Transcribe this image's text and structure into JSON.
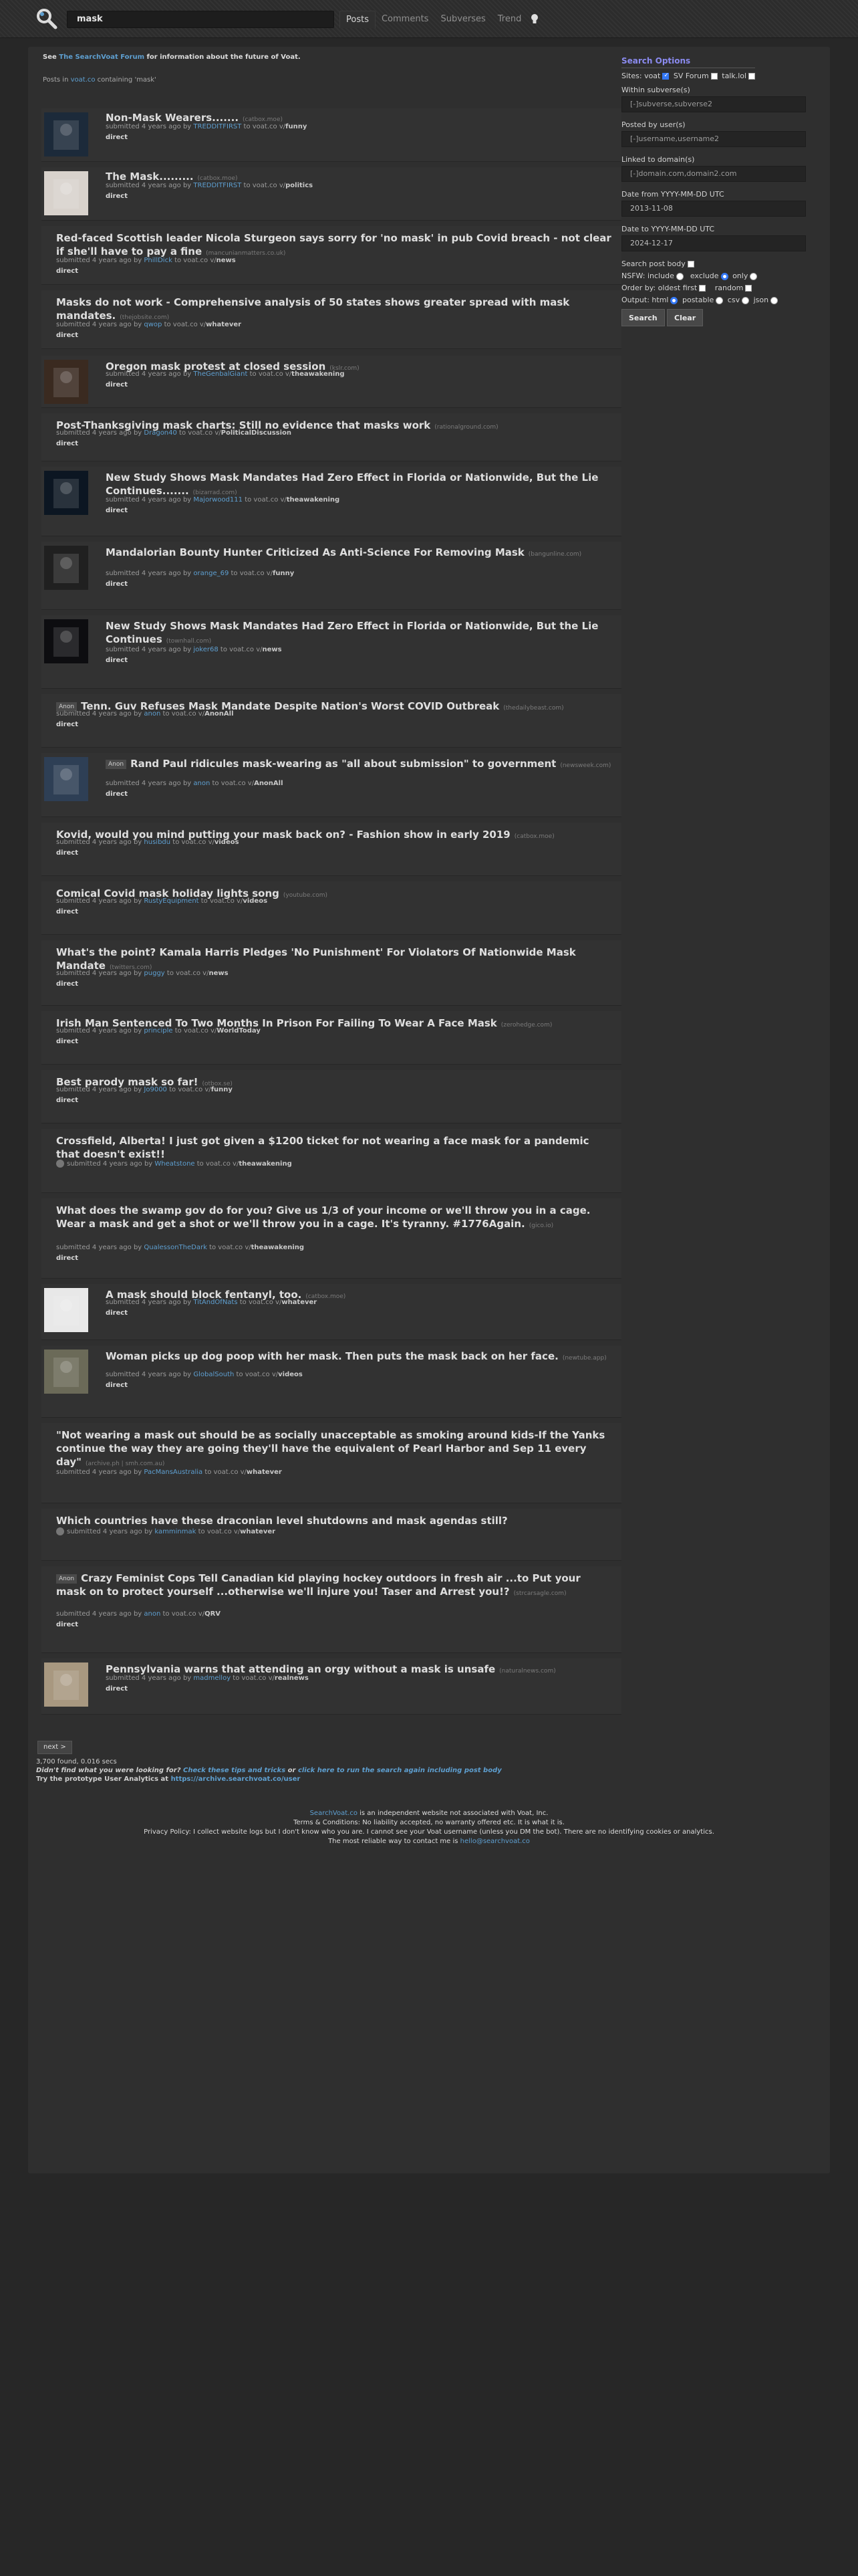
{
  "search": {
    "query": "mask"
  },
  "nav": {
    "posts": "Posts",
    "comments": "Comments",
    "subverses": "Subverses",
    "trend": "Trend"
  },
  "announce": {
    "pre": "See ",
    "link": "The SearchVoat Forum",
    "post": " for information about the future of Voat."
  },
  "posts_in": {
    "pre": "Posts in ",
    "link": "voat.co",
    "post": " containing 'mask'"
  },
  "posts": [
    {
      "title": "Non-Mask Wearers.......",
      "domain": "(catbox.moe)",
      "meta_pre": "submitted 4 years ago by ",
      "user": "TREDDITFIRST",
      "meta_mid": " to voat.co v/",
      "sub": "funny",
      "direct": "direct"
    },
    {
      "title": "The Mask.........",
      "domain": "(catbox.moe)",
      "meta_pre": "submitted 4 years ago by ",
      "user": "TREDDITFIRST",
      "meta_mid": " to voat.co v/",
      "sub": "politics",
      "direct": "direct"
    },
    {
      "title": "Red-faced Scottish leader Nicola Sturgeon says sorry for 'no mask' in pub Covid breach - not clear if she'll have to pay a fine",
      "domain": "(mancunianmatters.co.uk)",
      "meta_pre": "submitted 4 years ago by ",
      "user": "PhillDick",
      "meta_mid": " to voat.co v/",
      "sub": "news",
      "direct": "direct"
    },
    {
      "title": "Masks do not work - Comprehensive analysis of 50 states shows greater spread with mask mandates.",
      "domain": "(thejobsite.com)",
      "meta_pre": "submitted 4 years ago by ",
      "user": "qwop",
      "meta_mid": " to voat.co v/",
      "sub": "whatever",
      "direct": "direct"
    },
    {
      "title": "Oregon mask protest at closed session",
      "domain": "(kslr.com)",
      "meta_pre": "submitted 4 years ago by ",
      "user": "TheGenbalGiant",
      "meta_mid": " to voat.co v/",
      "sub": "theawakening",
      "direct": "direct"
    },
    {
      "title": "Post-Thanksgiving mask charts: Still no evidence that masks work",
      "domain": "(rationalground.com)",
      "meta_pre": "submitted 4 years ago by ",
      "user": "Dragon40",
      "meta_mid": " to voat.co v/",
      "sub": "PoliticalDiscussion",
      "direct": "direct"
    },
    {
      "title": "New Study Shows Mask Mandates Had Zero Effect in Florida or Nationwide, But the Lie Continues.......",
      "domain": "(bizarrad.com)",
      "meta_pre": "submitted 4 years ago by ",
      "user": "Majorwood111",
      "meta_mid": " to voat.co v/",
      "sub": "theawakening",
      "direct": "direct"
    },
    {
      "title": "Mandalorian Bounty Hunter Criticized As Anti-Science For Removing Mask",
      "domain": "(bangunline.com)",
      "meta_pre": "submitted 4 years ago by ",
      "user": "orange_69",
      "meta_mid": " to voat.co v/",
      "sub": "funny",
      "direct": "direct"
    },
    {
      "title": "New Study Shows Mask Mandates Had Zero Effect in Florida or Nationwide, But the Lie Continues",
      "domain": "(townhall.com)",
      "meta_pre": "submitted 4 years ago by ",
      "user": "joker68",
      "meta_mid": " to voat.co v/",
      "sub": "news",
      "direct": "direct"
    },
    {
      "anon": "Anon",
      "title": "Tenn. Guv Refuses Mask Mandate Despite Nation's Worst COVID Outbreak",
      "domain": "(thedailybeast.com)",
      "meta_pre": "submitted 4 years ago by ",
      "user": "anon",
      "meta_mid": " to voat.co v/",
      "sub": "AnonAll",
      "direct": "direct"
    },
    {
      "anon": "Anon",
      "title": "Rand Paul ridicules mask-wearing as \"all about submission\" to government",
      "domain": "(newsweek.com)",
      "meta_pre": "submitted 4 years ago by ",
      "user": "anon",
      "meta_mid": " to voat.co v/",
      "sub": "AnonAll",
      "direct": "direct"
    },
    {
      "title": "Kovid, would you mind putting your mask back on? - Fashion show in early 2019",
      "domain": "(catbox.moe)",
      "meta_pre": "submitted 4 years ago by ",
      "user": "husibdu",
      "meta_mid": " to voat.co v/",
      "sub": "videos",
      "direct": "direct"
    },
    {
      "title": "Comical Covid mask holiday lights song",
      "domain": "(youtube.com)",
      "meta_pre": "submitted 4 years ago by ",
      "user": "RustyEquipment",
      "meta_mid": " to voat.co v/",
      "sub": "videos",
      "direct": "direct"
    },
    {
      "title": "What's the point? Kamala Harris Pledges 'No Punishment' For Violators Of Nationwide Mask Mandate",
      "domain": "(twitters.com)",
      "meta_pre": "submitted 4 years ago by ",
      "user": "puggy",
      "meta_mid": " to voat.co v/",
      "sub": "news",
      "direct": "direct"
    },
    {
      "title": "Irish Man Sentenced To Two Months In Prison For Failing To Wear A Face Mask",
      "domain": "(zerohedge.com)",
      "meta_pre": "submitted 4 years ago by ",
      "user": "principle",
      "meta_mid": " to voat.co v/",
      "sub": "WorldToday",
      "direct": "direct"
    },
    {
      "title": "Best parody mask so far!",
      "domain": "(otbox.se)",
      "meta_pre": "submitted 4 years ago by ",
      "user": "Jo9000",
      "meta_mid": " to voat.co v/",
      "sub": "funny",
      "direct": "direct"
    },
    {
      "title": "Crossfield, Alberta! I just got given a $1200 ticket for not wearing a face mask for a pandemic that doesn't exist!!",
      "domain": "",
      "meta_pre": "submitted 4 years ago by ",
      "user": "Wheatstone",
      "meta_mid": " to voat.co v/",
      "sub": "theawakening",
      "direct": ""
    },
    {
      "title": "What does the swamp gov do for you? Give us 1/3 of your income or we'll throw you in a cage. Wear a mask and get a shot or we'll throw you in a cage. It's tyranny. #1776Again.",
      "domain": "(gico.io)",
      "meta_pre": "submitted 4 years ago by ",
      "user": "QualessonTheDark",
      "meta_mid": " to voat.co v/",
      "sub": "theawakening",
      "direct": "direct"
    },
    {
      "title": "A mask should block fentanyl, too.",
      "domain": "(catbox.moe)",
      "meta_pre": "submitted 4 years ago by ",
      "user": "TitAndOfNats",
      "meta_mid": " to voat.co v/",
      "sub": "whatever",
      "direct": "direct"
    },
    {
      "title": "Woman picks up dog poop with her mask. Then puts the mask back on her face.",
      "domain": "(newtube.app)",
      "meta_pre": "submitted 4 years ago by ",
      "user": "GlobalSouth",
      "meta_mid": " to voat.co v/",
      "sub": "videos",
      "direct": "direct"
    },
    {
      "title": "\"Not wearing a mask out should be as socially unacceptable as smoking around kids-If the Yanks continue the way they are going they'll have the equivalent of Pearl Harbor and Sep 11 every day\"",
      "domain": "(archive.ph | smh.com.au)",
      "meta_pre": "submitted 4 years ago by ",
      "user": "PacMansAustralia",
      "meta_mid": " to voat.co v/",
      "sub": "whatever",
      "direct": "direct"
    },
    {
      "title": "Which countries have these draconian level shutdowns and mask agendas still?",
      "domain": "",
      "meta_pre": "submitted 4 years ago by ",
      "user": "kamminmak",
      "meta_mid": " to voat.co v/",
      "sub": "whatever",
      "direct": ""
    },
    {
      "anon": "Anon",
      "title": "Crazy Feminist Cops Tell Canadian kid playing hockey outdoors in fresh air ...to Put your mask on to protect yourself ...otherwise we'll injure you! Taser and Arrest you!?",
      "domain": "(strcarsagle.com)",
      "meta_pre": "submitted 4 years ago by ",
      "user": "anon",
      "meta_mid": " to voat.co v/",
      "sub": "QRV",
      "direct": "direct"
    },
    {
      "title": "Pennsylvania warns that attending an orgy without a mask is unsafe",
      "domain": "(naturalnews.com)",
      "meta_pre": "submitted 4 years ago by ",
      "user": "madmelloy",
      "meta_mid": " to voat.co v/",
      "sub": "realnews",
      "direct": "direct"
    }
  ],
  "sidebar": {
    "title": "Search Options",
    "sites_label": "Sites:",
    "site_voat": "voat",
    "site_forum": "SV Forum",
    "site_talk": "talk.lol",
    "within_label": "Within subverse(s)",
    "within_placeholder": "[-]subverse,subverse2",
    "posted_label": "Posted by user(s)",
    "posted_placeholder": "[-]username,username2",
    "linked_label": "Linked to domain(s)",
    "linked_placeholder": "[-]domain.com,domain2.com",
    "date_from_label": "Date from YYYY-MM-DD UTC",
    "date_from_value": "2013-11-08",
    "date_to_label": "Date to YYYY-MM-DD UTC",
    "date_to_value": "2024-12-17",
    "search_body_label": "Search post body",
    "nsfw_label": "NSFW:",
    "nsfw_include": "include",
    "nsfw_exclude": "exclude",
    "nsfw_only": "only",
    "order_label": "Order by:",
    "order_oldest": "oldest first",
    "order_random": "random",
    "output_label": "Output:",
    "out_html": "html",
    "out_postable": "postable",
    "out_csv": "csv",
    "out_json": "json",
    "search_btn": "Search",
    "clear_btn": "Clear"
  },
  "pager": {
    "next": "next >"
  },
  "stats": {
    "found": "3,700 found, 0.016 secs"
  },
  "help": {
    "line1_pre": "Didn't find what you were looking for? ",
    "line1_link1": "Check these tips and tricks",
    "line1_mid": " or ",
    "line1_link2": "click here to run the search again including post body",
    "line2_pre": "Try the prototype User Analytics at ",
    "line2_link": "https://archive.searchvoat.co/user"
  },
  "footer": {
    "l1_link": "SearchVoat.co",
    "l1_rest": " is an independent website not associated with Voat, Inc.",
    "l2": "Terms & Conditions: No liability accepted, no warranty offered etc. It is what it is.",
    "l3": "Privacy Policy: I collect website logs but I don't know who you are. I cannot see your Voat username (unless you DM the bot). There are no identifying cookies or analytics.",
    "l4_pre": "The most reliable way to contact me is ",
    "l4_link": "hello@searchvoat.co"
  },
  "colors": {
    "background": "#272727",
    "panel": "#2f2f2f",
    "link": "#5e9fd0",
    "heading": "#8b8bf0",
    "radio": "#3478f6"
  }
}
